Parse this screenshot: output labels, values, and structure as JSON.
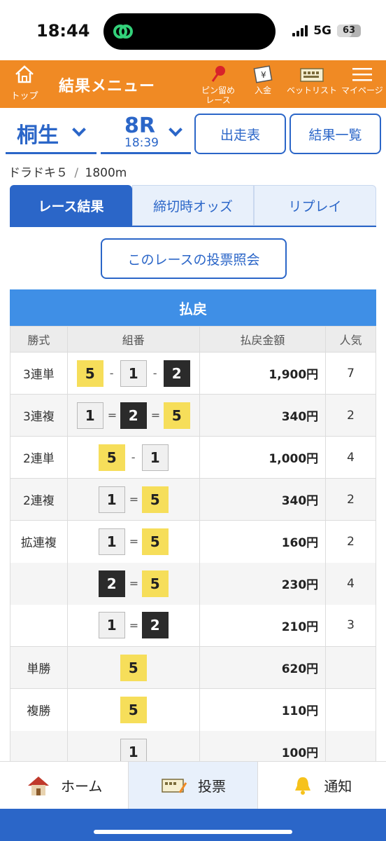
{
  "status_bar": {
    "time": "18:44",
    "network": "5G",
    "battery": "63",
    "battery_level": 0.63
  },
  "header": {
    "home_label": "トップ",
    "title": "結果メニュー",
    "pin_label_line1": "ピン留め",
    "pin_label_line2": "レース",
    "deposit_label": "入金",
    "betlist_label": "ベットリスト",
    "mypage_label": "マイページ",
    "icons": [
      "home-icon",
      "pin-icon",
      "deposit-icon",
      "betlist-icon",
      "menu-icon"
    ],
    "color": "#f08a24"
  },
  "selector": {
    "venue": "桐生",
    "race": "8R",
    "race_time": "18:39",
    "entry_list_button": "出走表",
    "results_list_button": "結果一覧"
  },
  "race_info": {
    "name": "ドラドキ５",
    "separator": "/",
    "distance": "1800m"
  },
  "tabs": [
    {
      "label": "レース結果",
      "active": true
    },
    {
      "label": "締切時オッズ",
      "active": false
    },
    {
      "label": "リプレイ",
      "active": false
    }
  ],
  "inquiry_button": "このレースの投票照会",
  "payout": {
    "section_title": "払戻",
    "headers": {
      "type": "勝式",
      "combo": "組番",
      "amount": "払戻金額",
      "popularity": "人気"
    },
    "rows": [
      {
        "type": "3連単",
        "combo": [
          "5",
          "-",
          "1",
          "-",
          "2"
        ],
        "amount": "1,900円",
        "popularity": "7"
      },
      {
        "type": "3連複",
        "combo": [
          "1",
          "=",
          "2",
          "=",
          "5"
        ],
        "amount": "340円",
        "popularity": "2"
      },
      {
        "type": "2連単",
        "combo": [
          "5",
          "-",
          "1"
        ],
        "amount": "1,000円",
        "popularity": "4"
      },
      {
        "type": "2連複",
        "combo": [
          "1",
          "=",
          "5"
        ],
        "amount": "340円",
        "popularity": "2"
      },
      {
        "type": "拡連複",
        "combo": [
          "1",
          "=",
          "5"
        ],
        "amount": "160円",
        "popularity": "2"
      },
      {
        "type": "",
        "combo": [
          "2",
          "=",
          "5"
        ],
        "amount": "230円",
        "popularity": "4"
      },
      {
        "type": "",
        "combo": [
          "1",
          "=",
          "2"
        ],
        "amount": "210円",
        "popularity": "3"
      },
      {
        "type": "単勝",
        "combo": [
          "5"
        ],
        "amount": "620円",
        "popularity": ""
      },
      {
        "type": "複勝",
        "combo": [
          "5"
        ],
        "amount": "110円",
        "popularity": ""
      },
      {
        "type": "",
        "combo": [
          "1"
        ],
        "amount": "100円",
        "popularity": ""
      }
    ],
    "box_colors": {
      "1": "#f0f0f0",
      "2": "#2b2b2b",
      "5": "#f6de5a"
    },
    "header_color": "#3f8fe6"
  },
  "bottom_nav": [
    {
      "label": "ホーム",
      "icon": "house-icon",
      "active": false
    },
    {
      "label": "投票",
      "icon": "ticket-icon",
      "active": true
    },
    {
      "label": "通知",
      "icon": "bell-icon",
      "active": false
    }
  ],
  "accent_color": "#2b66c8"
}
